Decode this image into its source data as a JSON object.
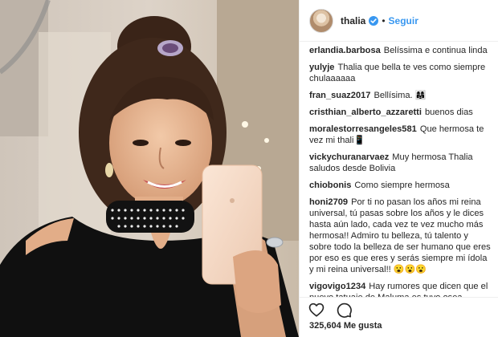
{
  "post": {
    "username": "thalia",
    "follow_label": "Seguir",
    "separator": "•",
    "verified_color": "#3897f0",
    "follow_color": "#3897f0",
    "likes_count": "325,604",
    "likes_label": "Me gusta"
  },
  "comments": [
    {
      "user": "erlandia.barbosa",
      "text": "Belíssima e continua linda"
    },
    {
      "user": "yulyje",
      "text": "Thalia que bella te ves como siempre chulaaaaaa"
    },
    {
      "user": "fran_suaz2017",
      "text": "Bellísima. 👩‍👩‍👧"
    },
    {
      "user": "cristhian_alberto_azzaretti",
      "text": "buenos dias"
    },
    {
      "user": "moralestorresangeles581",
      "text": "Que hermosa te vez mi thali📱"
    },
    {
      "user": "vickychuranarvaez",
      "text": "Muy hermosa Thalia saludos desde Bolivia"
    },
    {
      "user": "chiobonis",
      "text": "Como siempre hermosa"
    },
    {
      "user": "honi2709",
      "text": "Por ti no pasan los años mi reina universal, tú pasas sobre los años y le dices hasta aún lado, cada vez te vez mucho más hermosa!! Admiro tu belleza, tú talento y sobre todo la belleza de ser humano que eres por eso es que eres y serás siempre mi ídola y mi reina universal!! 😮😮😮"
    },
    {
      "user": "vigovigo1234",
      "text": "Hay rumores que dicen que el nuevo tatuaje de Maluma es tuyo,osea"
    }
  ],
  "icons": {
    "like": "heart-icon",
    "comment": "comment-bubble-icon",
    "verified": "verified-badge-icon"
  }
}
